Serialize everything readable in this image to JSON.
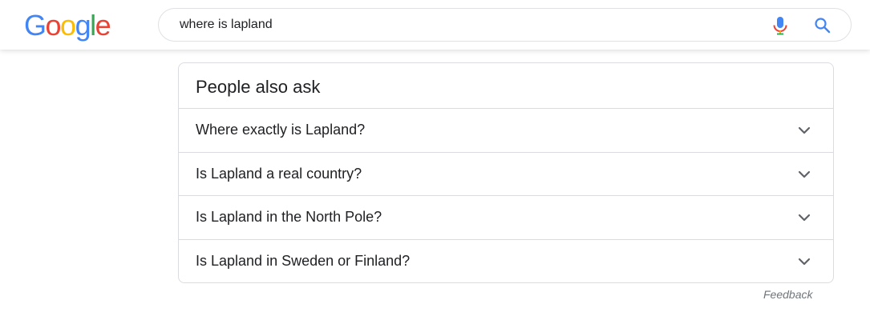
{
  "logo": {
    "letters": [
      {
        "char": "G",
        "color": "#4285F4"
      },
      {
        "char": "o",
        "color": "#EA4335"
      },
      {
        "char": "o",
        "color": "#FBBC05"
      },
      {
        "char": "g",
        "color": "#4285F4"
      },
      {
        "char": "l",
        "color": "#34A853"
      },
      {
        "char": "e",
        "color": "#EA4335"
      }
    ]
  },
  "search": {
    "value": "where is lapland",
    "mic_icon": "mic-icon",
    "search_icon": "search-icon",
    "accent": "#4285F4"
  },
  "people_also_ask": {
    "title": "People also ask",
    "questions": [
      {
        "label": "Where exactly is Lapland?",
        "icon": "chevron-down-icon"
      },
      {
        "label": "Is Lapland a real country?",
        "icon": "chevron-down-icon"
      },
      {
        "label": "Is Lapland in the North Pole?",
        "icon": "chevron-down-icon"
      },
      {
        "label": "Is Lapland in Sweden or Finland?",
        "icon": "chevron-down-icon"
      }
    ]
  },
  "feedback_label": "Feedback"
}
